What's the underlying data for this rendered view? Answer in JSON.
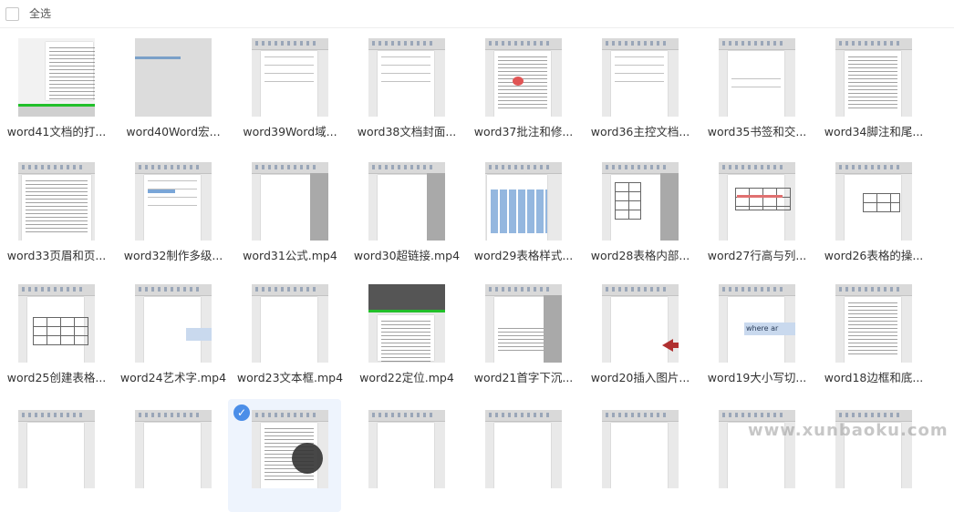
{
  "toolbar": {
    "select_all_label": "全选"
  },
  "files": {
    "row1": [
      "word41文档的打...",
      "word40Word宏...",
      "word39Word域...",
      "word38文档封面...",
      "word37批注和修...",
      "word36主控文档...",
      "word35书签和交...",
      "word34脚注和尾..."
    ],
    "row2": [
      "word33页眉和页...",
      "word32制作多级...",
      "word31公式.mp4",
      "word30超链接.mp4",
      "word29表格样式...",
      "word28表格内部...",
      "word27行高与列...",
      "word26表格的操..."
    ],
    "row3": [
      "word25创建表格...",
      "word24艺术字.mp4",
      "word23文本框.mp4",
      "word22定位.mp4",
      "word21首字下沉...",
      "word20插入图片...",
      "word19大小写切...",
      "word18边框和底..."
    ]
  },
  "thumb_text": {
    "word19_highlight": "where ar"
  },
  "selected_tile": "row4-3",
  "watermark": "www.xunbaoku.com",
  "colors": {
    "accent": "#4b8ee8",
    "selected_bg": "#eef4fd"
  }
}
